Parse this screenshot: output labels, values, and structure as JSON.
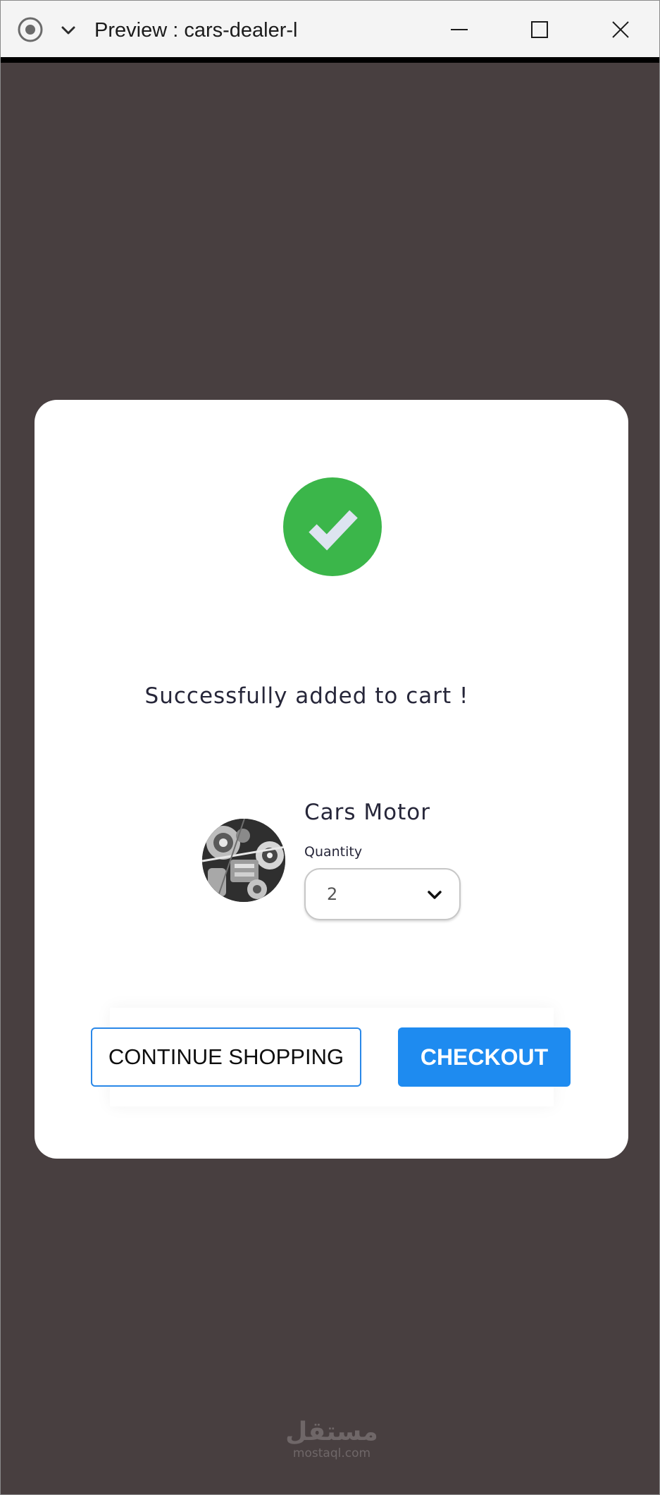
{
  "window": {
    "title": "Preview : cars-dealer-l",
    "icons": {
      "record": "record-icon",
      "menu": "chevron-down-icon",
      "minimize": "minimize-icon",
      "maximize": "maximize-icon",
      "close": "close-icon"
    }
  },
  "modal": {
    "status_icon": "checkmark-icon",
    "success_message": "Successfully added to cart !",
    "product": {
      "name": "Cars Motor",
      "thumbnail_icon": "engine-image",
      "quantity_label": "Quantity",
      "quantity_value": "2"
    },
    "actions": {
      "continue_label": "CONTINUE SHOPPING",
      "checkout_label": "CHECKOUT"
    }
  },
  "watermark": {
    "arabic": "مستقل",
    "latin": "mostaql.com"
  },
  "colors": {
    "backdrop": "#483f40",
    "success": "#3bb64a",
    "primary": "#1e8bf0",
    "outline": "#2a88e8"
  }
}
